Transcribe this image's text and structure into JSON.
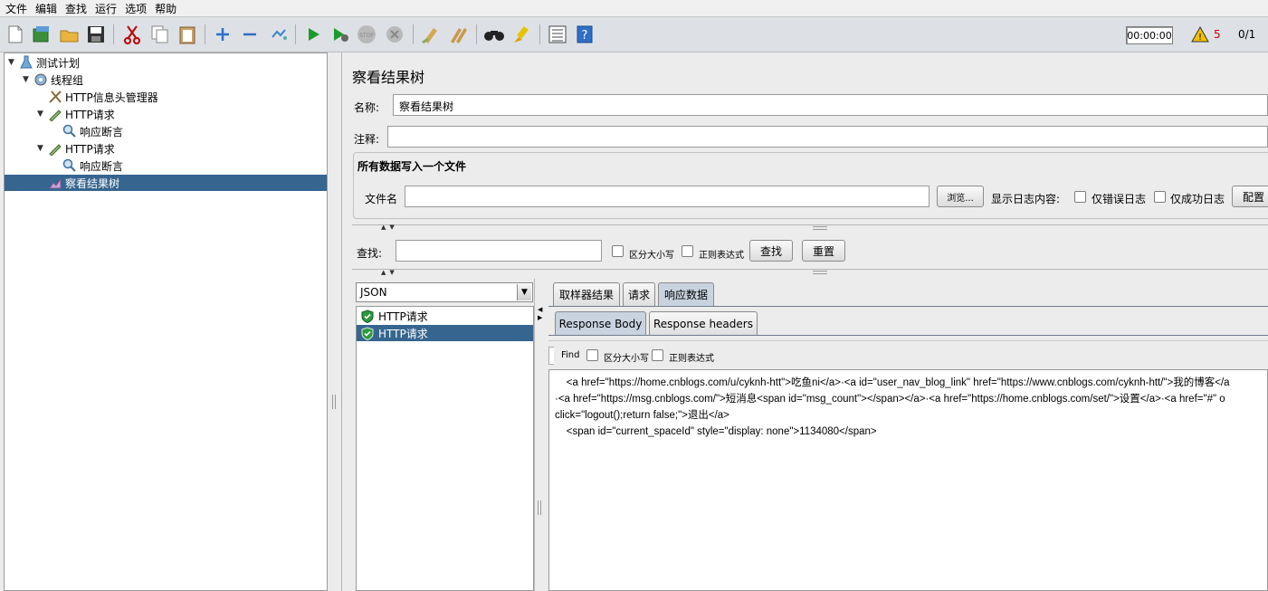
{
  "menu": [
    "文件",
    "编辑",
    "查找",
    "运行",
    "选项",
    "帮助"
  ],
  "toolbar": {
    "icons": [
      "new-icon",
      "templates-icon",
      "open-icon",
      "save-icon",
      "cut-icon",
      "copy-icon",
      "paste-icon",
      "expand-icon",
      "collapse-icon",
      "toggle-icon",
      "start-icon",
      "start-no-pause-icon",
      "stop-icon",
      "shutdown-icon",
      "clear-icon",
      "clear-all-icon",
      "search-icon",
      "reset-search-icon",
      "function-helper-icon",
      "help-icon"
    ],
    "timer": "00:00:00",
    "warning_count": "5",
    "threads": "0/1"
  },
  "tree": {
    "nodes": [
      {
        "label": "测试计划",
        "icon": "test-plan-icon"
      },
      {
        "label": "线程组",
        "icon": "thread-group-icon"
      },
      {
        "label": "HTTP信息头管理器",
        "icon": "config-element-icon"
      },
      {
        "label": "HTTP请求",
        "icon": "sampler-icon"
      },
      {
        "label": "响应断言",
        "icon": "assertion-icon"
      },
      {
        "label": "HTTP请求",
        "icon": "sampler-icon"
      },
      {
        "label": "响应断言",
        "icon": "assertion-icon"
      },
      {
        "label": "察看结果树",
        "icon": "listener-icon"
      }
    ]
  },
  "panel": {
    "title": "察看结果树",
    "name_label": "名称:",
    "name_value": "察看结果树",
    "comment_label": "注释:",
    "comment_value": "",
    "file_group_title": "所有数据写入一个文件",
    "filename_label": "文件名",
    "filename_value": "",
    "browse_button": "浏览...",
    "log_content_label": "显示日志内容:",
    "errors_only": "仅错误日志",
    "success_only": "仅成功日志",
    "configure_button": "配置"
  },
  "search": {
    "label": "查找:",
    "value": "",
    "case_sensitive": "区分大小写",
    "regex": "正则表达式",
    "find_button": "查找",
    "reset_button": "重置"
  },
  "renderer": {
    "selected": "JSON"
  },
  "results": [
    {
      "label": "HTTP请求",
      "status": "success"
    },
    {
      "label": "HTTP请求",
      "status": "success"
    }
  ],
  "tabs": {
    "main": [
      "取样器结果",
      "请求",
      "响应数据"
    ],
    "active_main": "响应数据",
    "sub": [
      "Response Body",
      "Response headers"
    ],
    "active_sub": "Response Body"
  },
  "body_search": {
    "find_label": "Find",
    "case_sensitive": "区分大小写",
    "regex": "正则表达式"
  },
  "response_body": "    <a href=\"https://home.cnblogs.com/u/cyknh-htt\">吃鱼ni</a>·<a id=\"user_nav_blog_link\" href=\"https://www.cnblogs.com/cyknh-htt/\">我的博客</a\n·<a href=\"https://msg.cnblogs.com/\">短消息<span id=\"msg_count\"></span></a>·<a href=\"https://home.cnblogs.com/set/\">设置</a>·<a href=\"#\" o\nclick=\"logout();return false;\">退出</a>\n    <span id=\"current_spaceId\" style=\"display: none\">1134080</span>"
}
